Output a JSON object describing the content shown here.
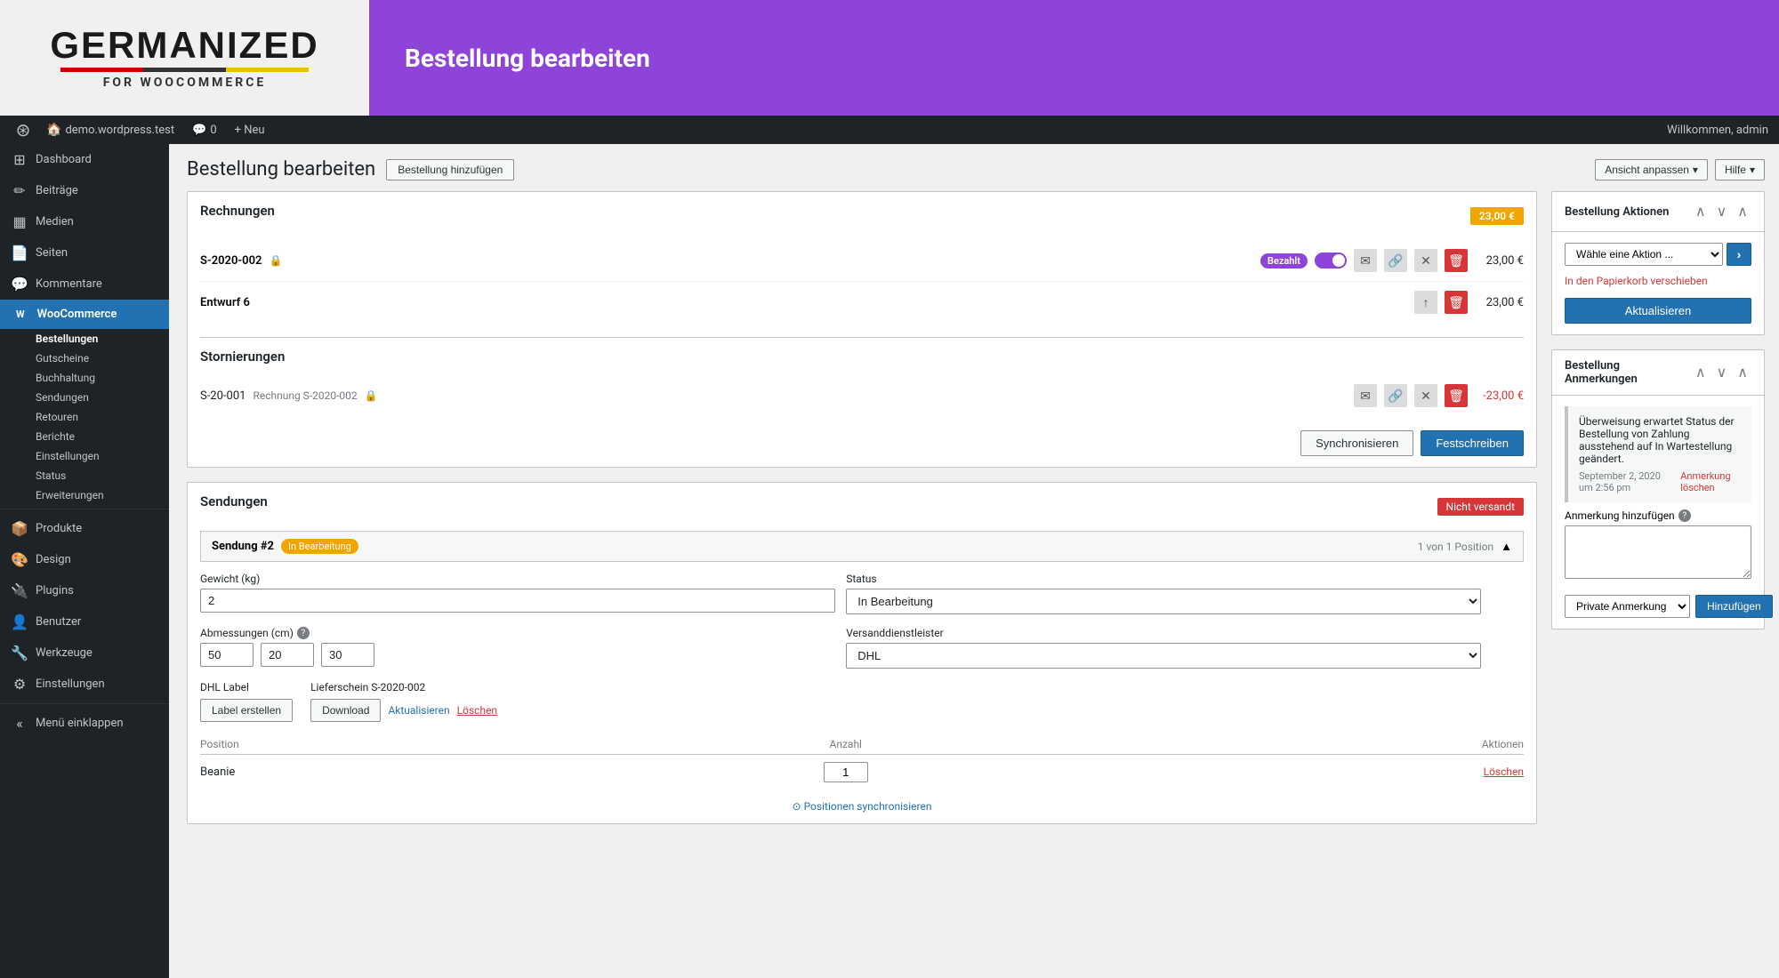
{
  "banner": {
    "logo_text": "GERMANIZED",
    "logo_sub": "FOR WOOCOMMERCE",
    "page_title": "Bestellung bearbeiten"
  },
  "adminbar": {
    "site": "demo.wordpress.test",
    "comments": "0",
    "new_label": "+ Neu",
    "welcome": "Willkommen, admin"
  },
  "header": {
    "title": "Bestellung bearbeiten",
    "add_button": "Bestellung hinzufügen",
    "ansicht": "Ansicht anpassen",
    "hilfe": "Hilfe"
  },
  "sidebar": {
    "items": [
      {
        "label": "Dashboard",
        "icon": "⊞"
      },
      {
        "label": "Beiträge",
        "icon": "✏"
      },
      {
        "label": "Medien",
        "icon": "▦"
      },
      {
        "label": "Seiten",
        "icon": "📄"
      },
      {
        "label": "Kommentare",
        "icon": "💬"
      },
      {
        "label": "WooCommerce",
        "icon": "W",
        "active": true
      }
    ],
    "woo_subitems": [
      {
        "label": "Bestellungen",
        "active": true
      },
      {
        "label": "Gutscheine"
      },
      {
        "label": "Buchhaltung"
      },
      {
        "label": "Sendungen"
      },
      {
        "label": "Retouren"
      },
      {
        "label": "Berichte"
      },
      {
        "label": "Einstellungen"
      },
      {
        "label": "Status"
      },
      {
        "label": "Erweiterungen"
      }
    ],
    "produkte": {
      "label": "Produkte",
      "icon": "📦"
    },
    "design": {
      "label": "Design",
      "icon": "🎨"
    },
    "plugins": {
      "label": "Plugins",
      "icon": "🔌"
    },
    "benutzer": {
      "label": "Benutzer",
      "icon": "👤"
    },
    "werkzeuge": {
      "label": "Werkzeuge",
      "icon": "🔧"
    },
    "einstellungen": {
      "label": "Einstellungen",
      "icon": "⚙"
    },
    "menue": {
      "label": "Menü einklappen",
      "icon": "«"
    }
  },
  "rechnungen": {
    "title": "Rechnungen",
    "amount_header": "23,00 €",
    "invoice1": {
      "number": "S-2020-002",
      "status": "Bezahlt",
      "amount": "23,00 €"
    },
    "invoice2": {
      "label": "Entwurf 6",
      "amount": "23,00 €"
    },
    "storno_title": "Stornierungen",
    "storno1": {
      "number": "S-20-001",
      "ref": "Rechnung S-2020-002",
      "amount": "-23,00 €"
    },
    "btn_sync": "Synchronisieren",
    "btn_festschreiben": "Festschreiben"
  },
  "sendungen": {
    "title": "Sendungen",
    "status_badge": "Nicht versandt",
    "sendung_title": "Sendung #2",
    "sendung_badge": "In Bearbeitung",
    "position_count": "1 von 1 Position",
    "weight_label": "Gewicht (kg)",
    "weight_value": "2",
    "status_label": "Status",
    "status_value": "In Bearbeitung",
    "abmessungen_label": "Abmessungen (cm)",
    "dim1": "50",
    "dim2": "20",
    "dim3": "30",
    "versand_label": "Versanddienstleister",
    "versand_value": "DHL",
    "dhl_label_label": "DHL Label",
    "btn_label_erstellen": "Label erstellen",
    "lieferschein_label": "Lieferschein S-2020-002",
    "btn_download": "Download",
    "link_aktualisieren": "Aktualisieren",
    "link_loeschen": "Löschen",
    "position_col1": "Position",
    "position_col2": "Anzahl",
    "position_col3": "Aktionen",
    "position_item": "Beanie",
    "position_qty": "1",
    "position_action": "Löschen",
    "sync_link": "⊙ Positionen synchronisieren"
  },
  "bestellung_aktionen": {
    "title": "Bestellung Aktionen",
    "select_placeholder": "Wähle eine Aktion ...",
    "trash_link": "In den Papierkorb verschieben",
    "btn_aktualisieren": "Aktualisieren"
  },
  "anmerkungen": {
    "title": "Bestellung Anmerkungen",
    "note_text": "Überweisung erwartet Status der Bestellung von Zahlung ausstehend auf In Wartestellung geändert.",
    "note_meta": "September 2, 2020 um 2:56 pm",
    "note_delete": "Anmerkung löschen",
    "add_label": "Anmerkung hinzufügen",
    "select_private": "Private Anmerkung",
    "btn_hinzufugen": "Hinzufügen"
  }
}
